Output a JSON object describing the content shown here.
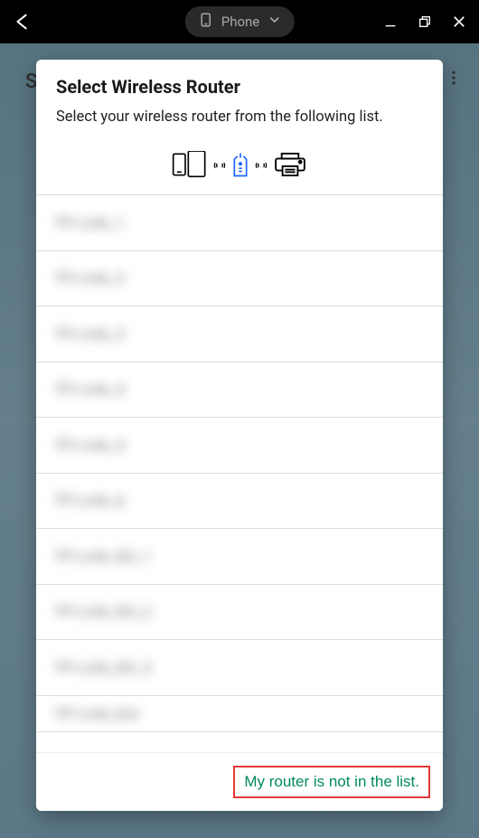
{
  "titlebar": {
    "device_label": "Phone"
  },
  "background": {
    "letter": "S"
  },
  "modal": {
    "title": "Select Wireless Router",
    "subtitle": "Select your wireless router from the following list.",
    "routers": [
      {
        "label": "TP-Link_1"
      },
      {
        "label": "TP-Link_2"
      },
      {
        "label": "TP-Link_3"
      },
      {
        "label": "TP-Link_4"
      },
      {
        "label": "TP-Link_5"
      },
      {
        "label": "TP-Link_6"
      },
      {
        "label": "TP-Link_EX_1"
      },
      {
        "label": "TP-Link_EX_2"
      },
      {
        "label": "TP-Link_EX_3"
      },
      {
        "label": "TP-Link_Ext"
      }
    ],
    "footer_button": "My router is not in the list."
  }
}
